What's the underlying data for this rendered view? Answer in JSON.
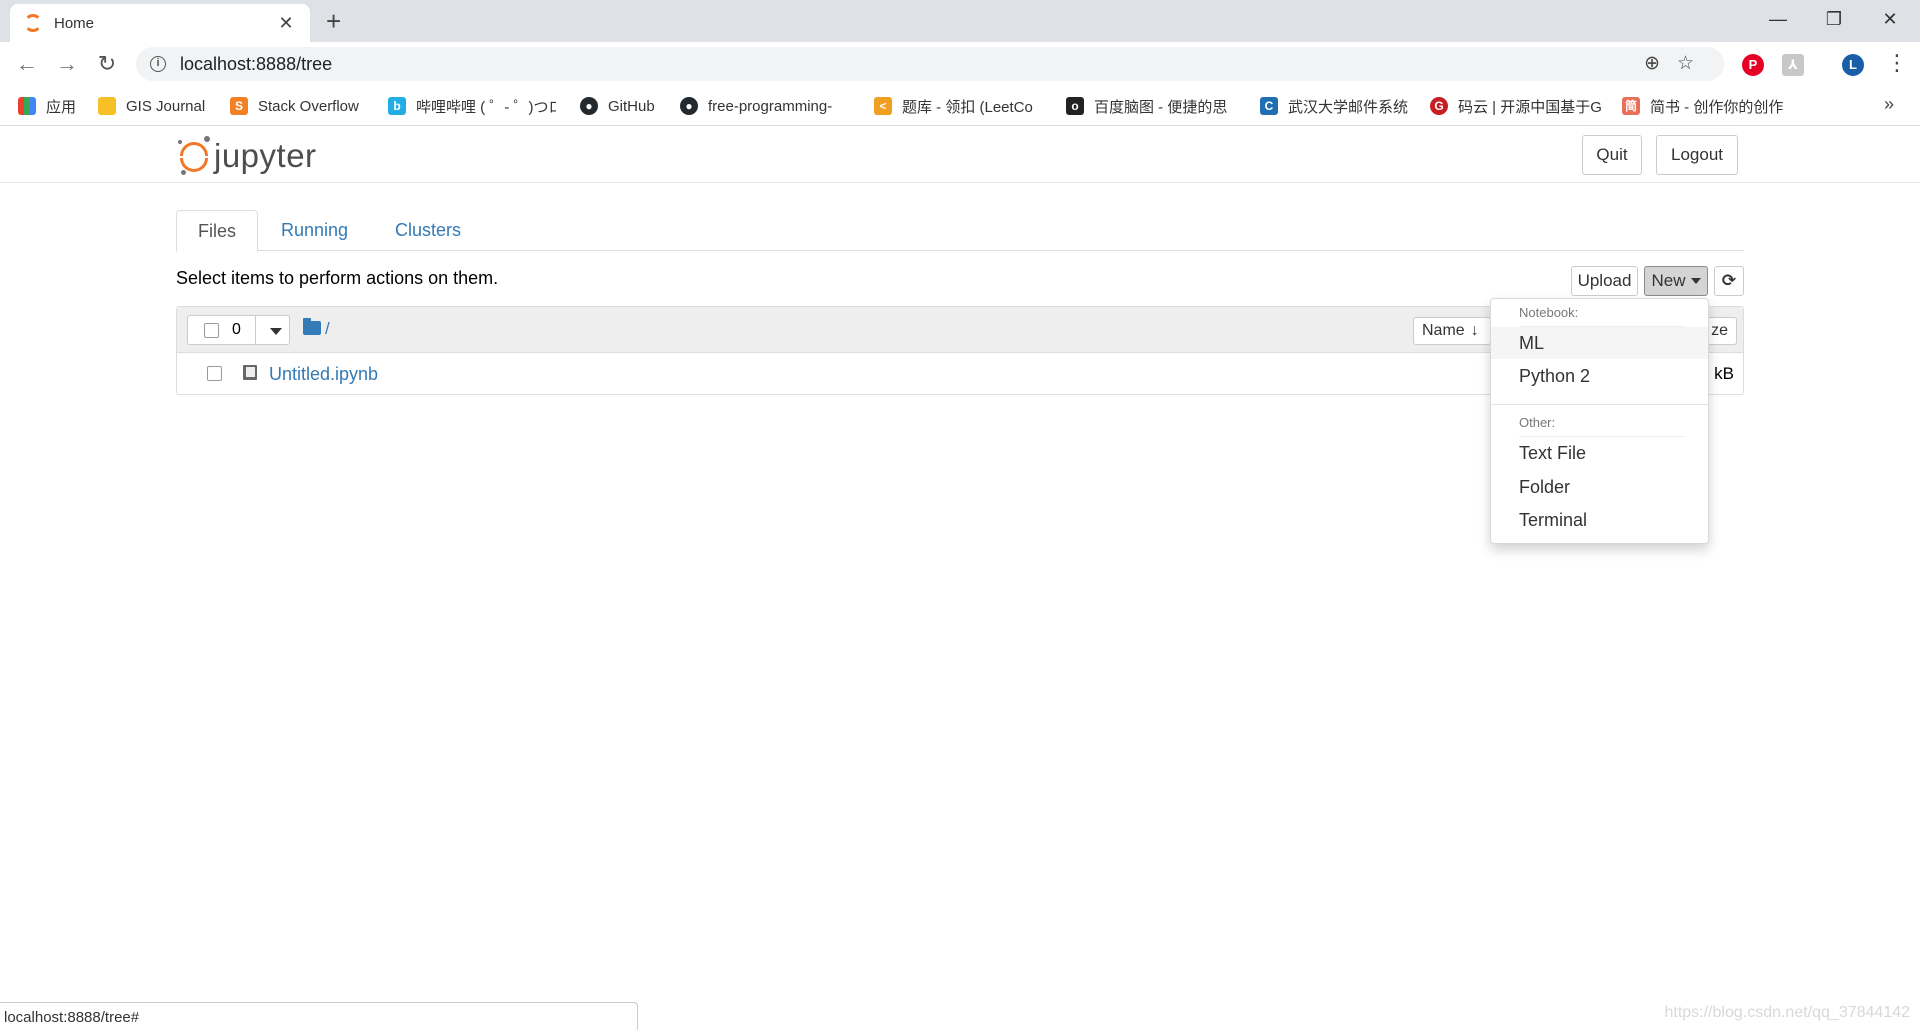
{
  "browser": {
    "tab_title": "Home",
    "tab_close": "✕",
    "new_tab": "+",
    "url": "localhost:8888/tree",
    "profile_initial": "L",
    "window": {
      "minimize": "—",
      "restore": "❐",
      "close": "✕"
    }
  },
  "bookmarks": [
    {
      "label": "应用",
      "color": "#e94235",
      "icon": "apps-grid-icon"
    },
    {
      "label": "GIS Journal",
      "color": "#f6c026",
      "icon": "folder-icon"
    },
    {
      "label": "Stack Overflow",
      "color": "#f48024",
      "icon": "stackoverflow-icon"
    },
    {
      "label": "哔哩哔哩 ( ゜- ゜)つロ",
      "color": "#23ade5",
      "icon": "bilibili-icon"
    },
    {
      "label": "GitHub",
      "color": "#24292e",
      "icon": "github-icon"
    },
    {
      "label": "free-programming-",
      "color": "#24292e",
      "icon": "github-icon"
    },
    {
      "label": "题库 - 领扣 (LeetCo",
      "color": "#f0a020",
      "icon": "leetcode-icon"
    },
    {
      "label": "百度脑图 - 便捷的思",
      "color": "#222222",
      "icon": "naotu-icon"
    },
    {
      "label": "武汉大学邮件系统",
      "color": "#1f6fb2",
      "icon": "whu-mail-icon"
    },
    {
      "label": "码云 | 开源中国基于G",
      "color": "#c71d23",
      "icon": "gitee-icon"
    },
    {
      "label": "简书 - 创作你的创作",
      "color": "#ea6f5a",
      "icon": "jianshu-icon"
    }
  ],
  "bookmarks_more": "»",
  "header": {
    "logo_text": "jupyter",
    "quit_label": "Quit",
    "logout_label": "Logout"
  },
  "tabs": [
    {
      "label": "Files",
      "active": true
    },
    {
      "label": "Running",
      "active": false
    },
    {
      "label": "Clusters",
      "active": false
    }
  ],
  "hint": "Select items to perform actions on them.",
  "actions": {
    "upload_label": "Upload",
    "new_label": "New",
    "refresh_icon": "refresh-icon"
  },
  "list": {
    "selected_count": "0",
    "breadcrumb": "/",
    "sort_name_label": "Name",
    "sort_arrow": "🡣",
    "size_header_fragment": "ze",
    "items": [
      {
        "name": "Untitled.ipynb",
        "size_fragment": "kB"
      }
    ]
  },
  "new_menu": {
    "notebook_header": "Notebook:",
    "notebooks": [
      "ML",
      "Python 2"
    ],
    "other_header": "Other:",
    "others": [
      "Text File",
      "Folder",
      "Terminal"
    ]
  },
  "status_url": "localhost:8888/tree#",
  "watermark": "https://blog.csdn.net/qq_37844142"
}
